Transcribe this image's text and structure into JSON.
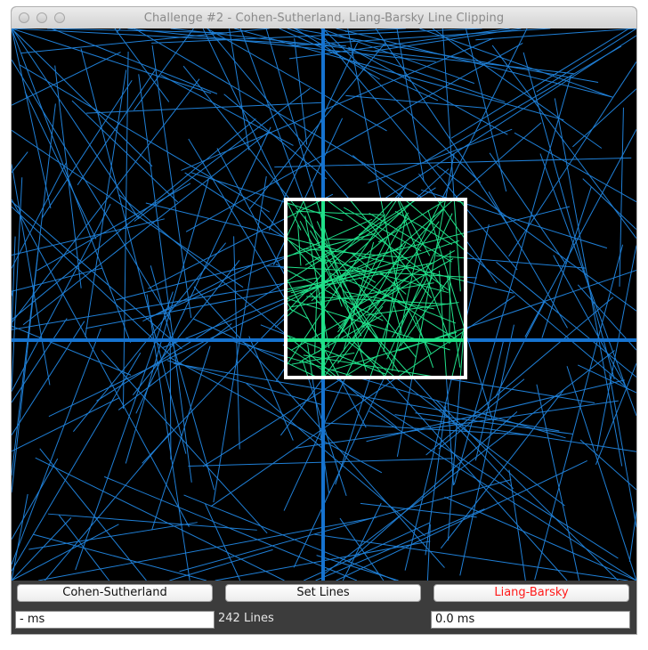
{
  "window": {
    "title": "Challenge #2 - Cohen-Sutherland, Liang-Barsky Line Clipping"
  },
  "colors": {
    "background": "#000000",
    "lines": "#1f7fd6",
    "clipped_lines": "#20e08a",
    "axes": "#1673d0",
    "clip_rect": "#ffffff",
    "active_button_text": "#ff1a1a"
  },
  "controls": {
    "cohen_sutherland_label": "Cohen-Sutherland",
    "set_lines_label": "Set Lines",
    "liang_barsky_label": "Liang-Barsky",
    "cohen_time": "- ms",
    "line_count": "242 Lines",
    "liang_time": "0.0 ms"
  },
  "scene": {
    "line_count": 242
  },
  "icons": [
    "close-icon",
    "minimize-icon",
    "zoom-icon"
  ]
}
